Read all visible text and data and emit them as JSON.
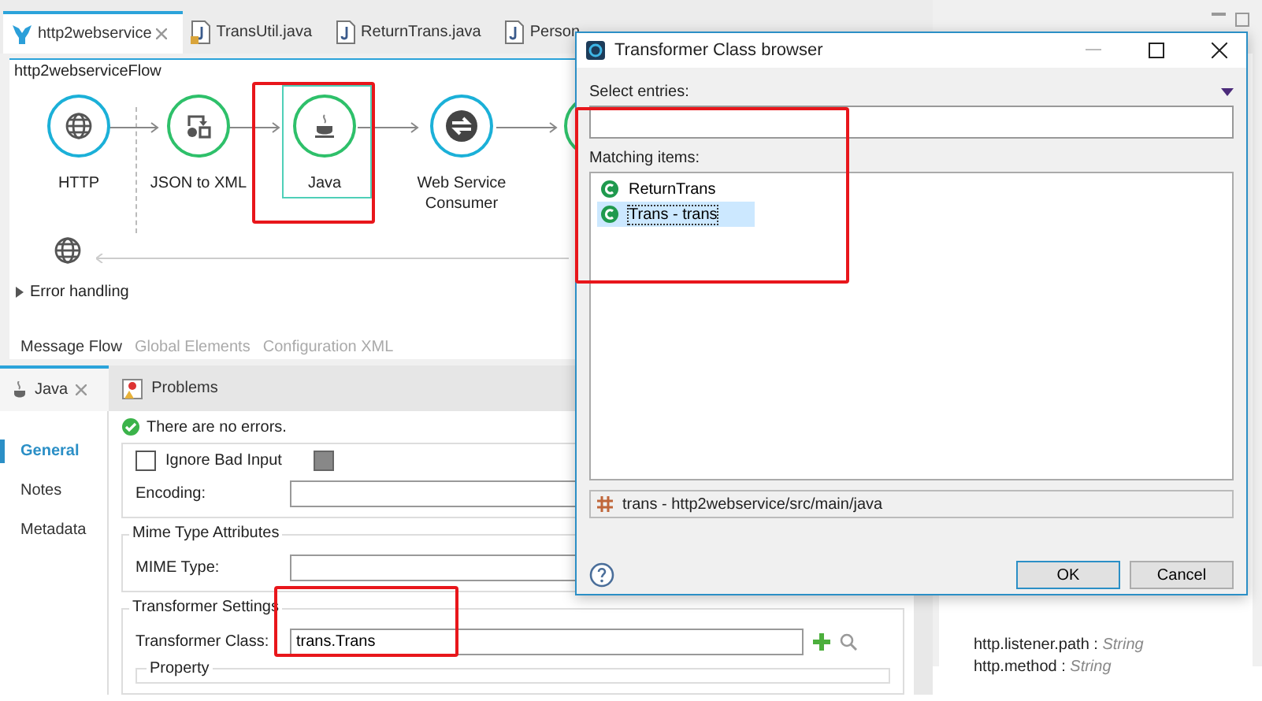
{
  "editor_tabs": [
    {
      "label": "http2webservice",
      "kind": "flow",
      "selected": true
    },
    {
      "label": "TransUtil.java",
      "kind": "java-locked",
      "selected": false
    },
    {
      "label": "ReturnTrans.java",
      "kind": "java",
      "selected": false
    },
    {
      "label": "Person",
      "kind": "java",
      "selected": false
    }
  ],
  "flow": {
    "name": "http2webserviceFlow",
    "nodes": [
      {
        "label": "HTTP",
        "kind": "http",
        "selected": false
      },
      {
        "label": "JSON to XML",
        "kind": "transform",
        "selected": false
      },
      {
        "label": "Java",
        "kind": "java",
        "selected": true
      },
      {
        "label": "Web Service Consumer",
        "kind": "webservice",
        "selected": false
      }
    ],
    "error_handling": "Error handling"
  },
  "view_tabs": [
    {
      "label": "Message Flow",
      "selected": true
    },
    {
      "label": "Global Elements",
      "selected": false
    },
    {
      "label": "Configuration XML",
      "selected": false
    }
  ],
  "properties_tabs": [
    {
      "label": "Java",
      "kind": "java",
      "selected": true
    },
    {
      "label": "Problems",
      "kind": "problems",
      "selected": false
    }
  ],
  "properties_nav": [
    {
      "label": "General",
      "selected": true
    },
    {
      "label": "Notes",
      "selected": false
    },
    {
      "label": "Metadata",
      "selected": false
    }
  ],
  "status": "There are no errors.",
  "ignore_bad_input": {
    "label": "Ignore Bad Input",
    "checked": false
  },
  "encoding": {
    "label": "Encoding:"
  },
  "mime_group": {
    "title": "Mime Type Attributes",
    "label": "MIME Type:"
  },
  "transformer_group": {
    "title": "Transformer Settings",
    "label": "Transformer Class:",
    "value": "trans.Trans",
    "subgroup": "Property"
  },
  "properties": [
    {
      "text": "http.listener.path : *String*"
    },
    {
      "text": "http.method : *String*"
    }
  ],
  "dialog": {
    "title": "Transformer Class browser",
    "filter_label": "Select entries:",
    "list_label": "Matching items:",
    "items": [
      {
        "label": "ReturnTrans",
        "selected": false
      },
      {
        "label": "Trans - trans",
        "selected": true
      }
    ],
    "location": "trans - http2webservice/src/main/java",
    "buttons": [
      {
        "label": "OK",
        "kind": "default"
      },
      {
        "label": "Cancel",
        "kind": "normal"
      }
    ]
  }
}
